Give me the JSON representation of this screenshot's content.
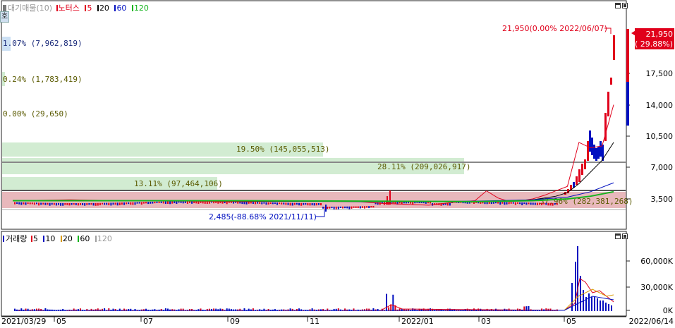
{
  "price_legend": {
    "title": "대기매물(10)",
    "stock": "노터스",
    "ma": [
      "5",
      "20",
      "60",
      "120"
    ],
    "ma_colors": [
      "#e0001b",
      "#000000",
      "#0010c0",
      "#14b41e"
    ]
  },
  "volume_legend": {
    "title": "거래량",
    "ma": [
      "5",
      "10",
      "20",
      "60",
      "120"
    ],
    "ma_colors": [
      "#e0001b",
      "#0010c0",
      "#d99a00",
      "#14b41e",
      "#a0a0a0"
    ]
  },
  "side_tab": "호",
  "annotations": {
    "high": "21,950(0.00% 2022/06/07)",
    "low": "2,485(-88.68% 2021/11/11)",
    "current_price": "21,950",
    "current_change": "( 29.88%)"
  },
  "date_start": "2021/03/29",
  "date_end": "2022/06/14",
  "colors": {
    "up": "#e0001b",
    "down": "#0010c0",
    "ma5": "#e0001b",
    "ma20": "#000000",
    "ma60": "#0010c0",
    "ma120": "#14b41e",
    "band_green": "#d2ecd2",
    "band_blue": "#cce0f4",
    "band_pink": "#e8b8bc",
    "band_olive": "#5a5a00"
  },
  "chart_data": [
    {
      "type": "line",
      "title": "노터스",
      "y_ticks": [
        "17,500",
        "14,000",
        "10,500",
        "7,000",
        "3,500"
      ],
      "x_ticks": [
        "05",
        "07",
        "09",
        "11",
        "2022/01",
        "03",
        "05"
      ],
      "ylim": [
        0,
        24000
      ],
      "price_levels": [
        3750,
        4600,
        4800,
        7500
      ],
      "volume_profile": [
        {
          "label": "1.07% (7,962,819)",
          "pct": 1.07,
          "price": 24000
        },
        {
          "label": "0.24% (1,783,419)",
          "pct": 0.24,
          "price": 20000
        },
        {
          "label": "0.00% (29,650)",
          "pct": 0.0,
          "price": 16500
        },
        {
          "label": "19.50% (145,055,513)",
          "pct": 19.5,
          "price": 11750
        },
        {
          "label": "28.11% (209,026,917)",
          "pct": 28.11,
          "price": 10100
        },
        {
          "label": "13.11% (97,464,106)",
          "pct": 13.11,
          "price": 7300
        },
        {
          "label": "37.96% (282,381,268)",
          "pct": 37.96,
          "price": 5000
        }
      ],
      "series": [
        {
          "name": "5",
          "x": [
            0,
            10,
            20,
            30,
            40,
            50,
            60,
            64,
            68,
            72,
            76,
            80,
            82,
            84,
            86,
            88,
            90,
            92,
            94,
            96,
            98,
            100,
            102,
            104
          ],
          "y": [
            3300,
            3400,
            3300,
            3250,
            3200,
            3300,
            3200,
            3000,
            2900,
            2800,
            3100,
            3300,
            4400,
            3600,
            3200,
            3300,
            3500,
            3900,
            4400,
            4900,
            9800,
            9200,
            9400,
            14000
          ]
        },
        {
          "name": "20",
          "x": [
            0,
            20,
            40,
            60,
            80,
            90,
            94,
            96,
            98,
            100,
            102,
            104
          ],
          "y": [
            3300,
            3300,
            3250,
            3200,
            3200,
            3400,
            3800,
            4200,
            5200,
            6500,
            7800,
            9800
          ]
        },
        {
          "name": "60",
          "x": [
            0,
            20,
            40,
            60,
            80,
            90,
            96,
            100,
            104
          ],
          "y": [
            3300,
            3300,
            3300,
            3200,
            3250,
            3400,
            3700,
            4300,
            5300
          ]
        },
        {
          "name": "120",
          "x": [
            0,
            40,
            60,
            80,
            90,
            96,
            100,
            104
          ],
          "y": [
            3300,
            3300,
            3250,
            3200,
            3300,
            3500,
            3800,
            4300
          ]
        }
      ]
    },
    {
      "type": "bar",
      "title": "거래량",
      "y_ticks": [
        "60,000K",
        "30,000K",
        "0K"
      ],
      "ylim": [
        0,
        85000
      ],
      "x": [
        0,
        10,
        20,
        30,
        40,
        50,
        60,
        65,
        70,
        75,
        80,
        82,
        83,
        84,
        86,
        88,
        90,
        92,
        94,
        96,
        97,
        98,
        99,
        100,
        101,
        102,
        103,
        104
      ],
      "values": [
        1000,
        800,
        900,
        700,
        600,
        800,
        900,
        500,
        400,
        600,
        2000,
        25000,
        15000,
        4000,
        2000,
        1500,
        1200,
        1500,
        3000,
        6000,
        78000,
        82000,
        40000,
        35000,
        32000,
        30000,
        28000,
        25000
      ]
    }
  ]
}
